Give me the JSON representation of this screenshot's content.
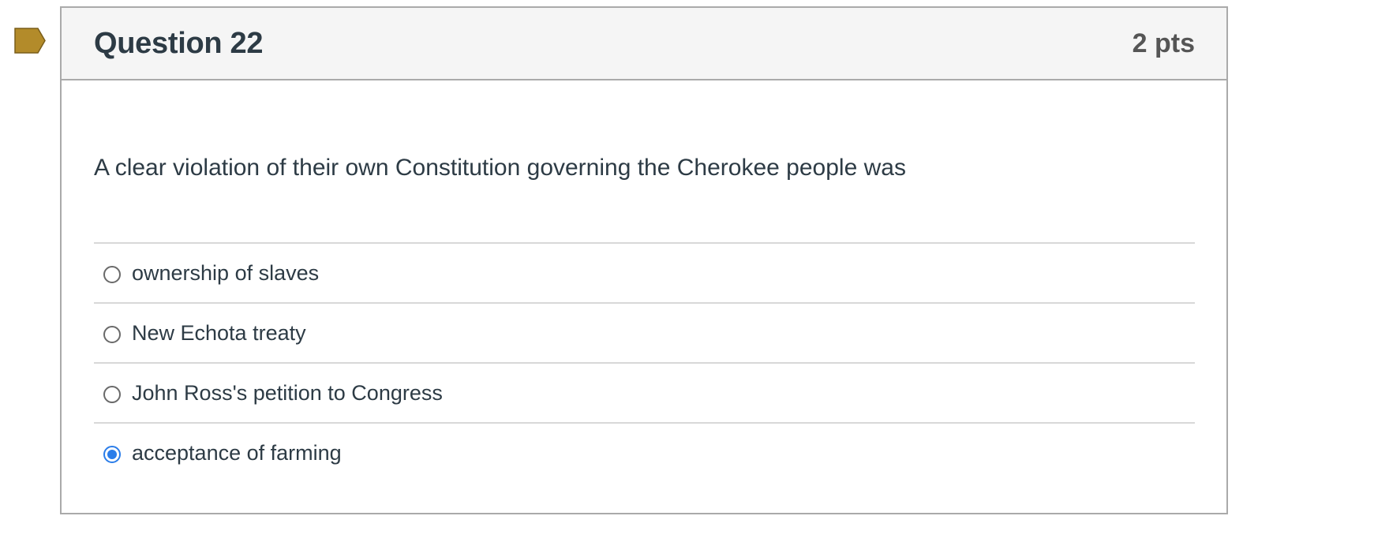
{
  "question": {
    "title": "Question 22",
    "points": "2 pts",
    "text": "A clear violation of their own Constitution governing the Cherokee people was",
    "flag_icon": "flag-icon",
    "flag_color": "#b38b2a"
  },
  "answers": [
    {
      "label": "ownership of slaves",
      "selected": false
    },
    {
      "label": "New Echota treaty",
      "selected": false
    },
    {
      "label": "John Ross's petition to Congress",
      "selected": false
    },
    {
      "label": "acceptance of farming",
      "selected": true
    }
  ],
  "colors": {
    "accent": "#2b7de9",
    "text": "#2d3b45",
    "header_bg": "#f5f5f5",
    "border": "#aaaaaa"
  }
}
